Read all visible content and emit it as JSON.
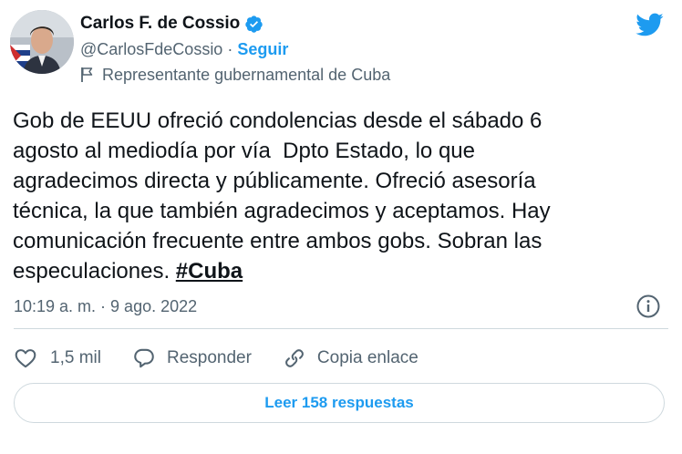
{
  "author": {
    "display_name": "Carlos F. de Cossio",
    "handle": "@CarlosFdeCossio",
    "separator": "·",
    "follow_label": "Seguir",
    "account_label": "Representante gubernamental de Cuba",
    "verified": true
  },
  "tweet": {
    "text": "Gob de EEUU ofreció condolencias desde el sábado 6\nagosto al mediodía por vía  Dpto Estado, lo que\nagradecimos directa y públicamente. Ofreció asesoría\ntécnica, la que también agradecimos y aceptamos. Hay\ncomunicación frecuente entre ambos gobs. Sobran las\nespeculaciones. ",
    "hashtag": "#Cuba",
    "timestamp": "10:19 a. m. · 9 ago. 2022"
  },
  "actions": {
    "like_count": "1,5 mil",
    "reply_label": "Responder",
    "copy_label": "Copia enlace"
  },
  "replies_button": "Leer 158 respuestas",
  "colors": {
    "accent": "#1d9bf0",
    "text": "#0f1419",
    "muted": "#536471",
    "border": "#cfd9de"
  },
  "icons": [
    "verified-badge-icon",
    "flag-icon",
    "twitter-bird-icon",
    "info-icon",
    "heart-icon",
    "reply-bubble-icon",
    "link-icon"
  ]
}
